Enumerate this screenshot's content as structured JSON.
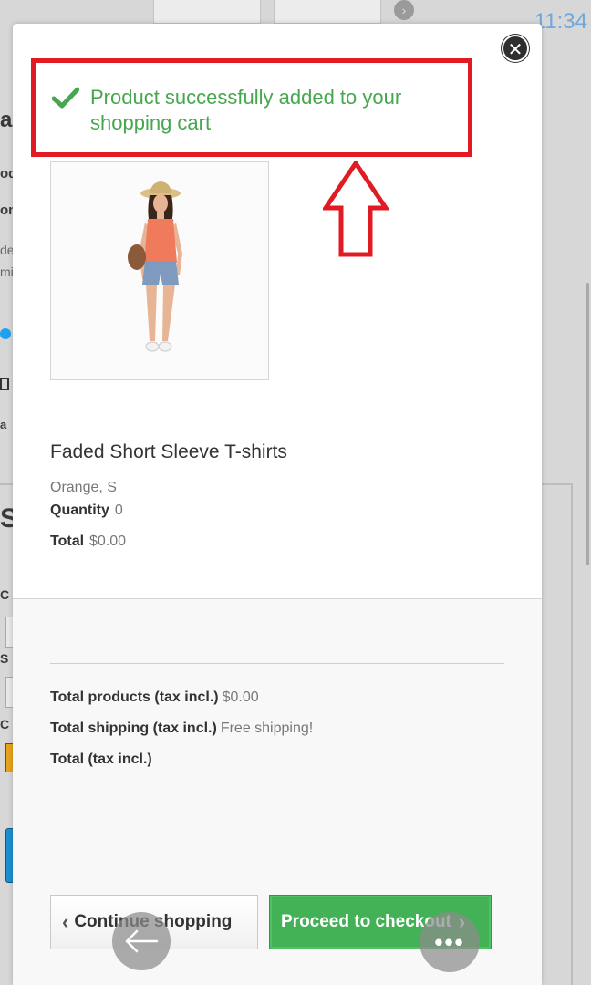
{
  "status_bar": {
    "time": "11:34"
  },
  "background": {
    "fragments": [
      "ac",
      "od",
      "on",
      "de",
      "mi",
      "a",
      "S",
      "C",
      "S",
      "C"
    ]
  },
  "modal": {
    "success_message": "Product successfully added to your shopping cart",
    "product": {
      "name": "Faded Short Sleeve T-shirts",
      "attributes": "Orange, S",
      "quantity_label": "Quantity",
      "quantity_value": "0",
      "total_label": "Total",
      "total_value": "$0.00"
    },
    "cart_summary": {
      "total_products_label": "Total products (tax incl.)",
      "total_products_value": "$0.00",
      "total_shipping_label": "Total shipping (tax incl.)",
      "total_shipping_value": "Free shipping!",
      "total_label": "Total (tax incl.)",
      "total_value": ""
    },
    "buttons": {
      "continue_label": "Continue shopping",
      "checkout_label": "Proceed to checkout"
    }
  },
  "colors": {
    "success_green": "#46a74e",
    "annotation_red": "#e01b24",
    "checkout_green": "#43b155",
    "clock_blue": "#6fa8dc"
  },
  "icons": [
    "check-icon",
    "close-icon",
    "chevron-left-icon",
    "chevron-right-icon",
    "up-arrow-annotation",
    "back-arrow-icon",
    "more-icon"
  ]
}
